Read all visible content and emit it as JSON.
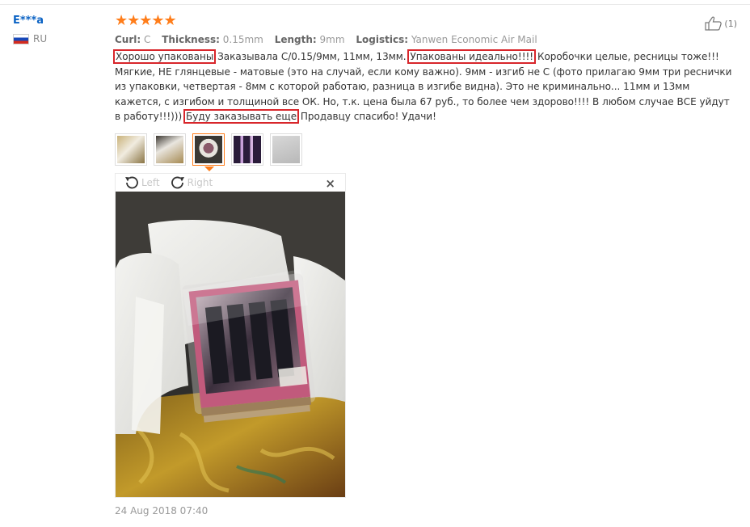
{
  "reviewer": {
    "name": "E***a",
    "country": "RU"
  },
  "rating": {
    "stars": "★★★★★",
    "value": 5
  },
  "helpful": {
    "count": "(1)"
  },
  "attributes": [
    {
      "key": "Curl:",
      "value": "C"
    },
    {
      "key": "Thickness:",
      "value": "0.15mm"
    },
    {
      "key": "Length:",
      "value": "9mm"
    },
    {
      "key": "Logistics:",
      "value": "Yanwen Economic Air Mail"
    }
  ],
  "review": {
    "hl1": "Хорошо упакованы",
    "t1": " Заказывала С/0.15/9мм, 11мм, 13мм. ",
    "hl2": "Упакованы идеально!!!!",
    "t2": " Коробочки целые, ресницы тоже!!! Мягкие, НЕ глянцевые - матовые (это на случай, если кому важно). 9мм - изгиб не С (фото прилагаю 9мм три реснички из упаковки, четвертая - 8мм с которой работаю, разница в изгибе видна). Это не криминально... 11мм и 13мм кажется, с изгибом и толщиной все ОК. Но, т.к. цена была 67 руб., то более чем здорово!!!! В любом случае ВСЕ уйдут в работу!!!))) ",
    "hl3": "Буду заказывать еще",
    "t3": " Продавцу спасибо! Удачи!"
  },
  "viewer": {
    "left_label": "Left",
    "right_label": "Right",
    "close": "×"
  },
  "date": "24 Aug 2018 07:40",
  "colors": {
    "accent": "#ff7d1a",
    "highlight_box": "#d8262b",
    "link": "#0a62c4"
  }
}
